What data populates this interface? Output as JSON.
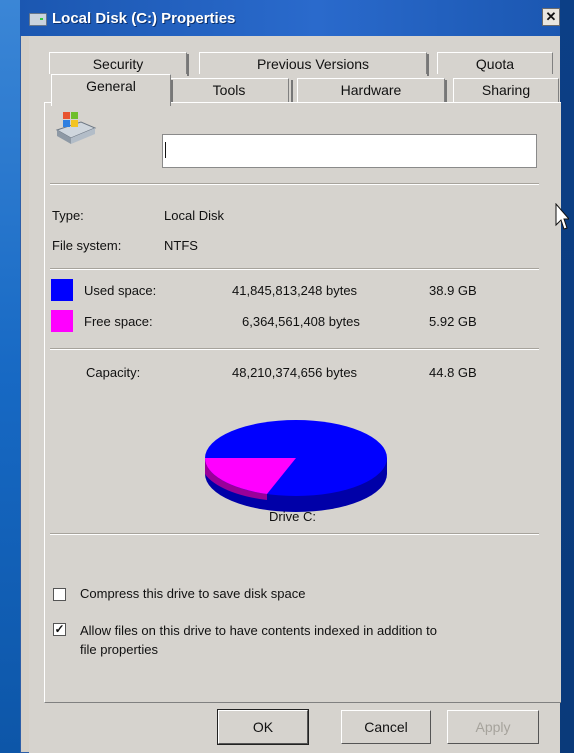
{
  "window": {
    "title": "Local Disk (C:) Properties",
    "close_glyph": "✕"
  },
  "tabs": {
    "row1": [
      "Security",
      "Previous Versions",
      "Quota"
    ],
    "row2": [
      "General",
      "Tools",
      "Hardware",
      "Sharing"
    ],
    "selected": "General"
  },
  "general": {
    "drive_label_value": "",
    "type_label": "Type:",
    "type_value": "Local Disk",
    "fs_label": "File system:",
    "fs_value": "NTFS"
  },
  "space": {
    "used": {
      "label": "Used space:",
      "bytes": "41,845,813,248 bytes",
      "size": "38.9 GB",
      "color": "#0000ff"
    },
    "free": {
      "label": "Free space:",
      "bytes": "6,364,561,408 bytes",
      "size": "5.92 GB",
      "color": "#ff00ff"
    },
    "capacity": {
      "label": "Capacity:",
      "bytes": "48,210,374,656 bytes",
      "size": "44.8 GB"
    }
  },
  "pie": {
    "caption": "Drive C:",
    "free_fraction": 0.123
  },
  "options": {
    "compress": {
      "label": "Compress this drive to save disk space",
      "checked": false
    },
    "index": {
      "label_line1": "Allow files on this drive to have contents indexed in addition to",
      "label_line2": "file properties",
      "checked": true,
      "check_glyph": "✓"
    }
  },
  "buttons": {
    "ok": "OK",
    "cancel": "Cancel",
    "apply": "Apply"
  },
  "colors": {
    "title_bar": "#1b57b1",
    "dialog_bg": "#d6d3ce"
  }
}
